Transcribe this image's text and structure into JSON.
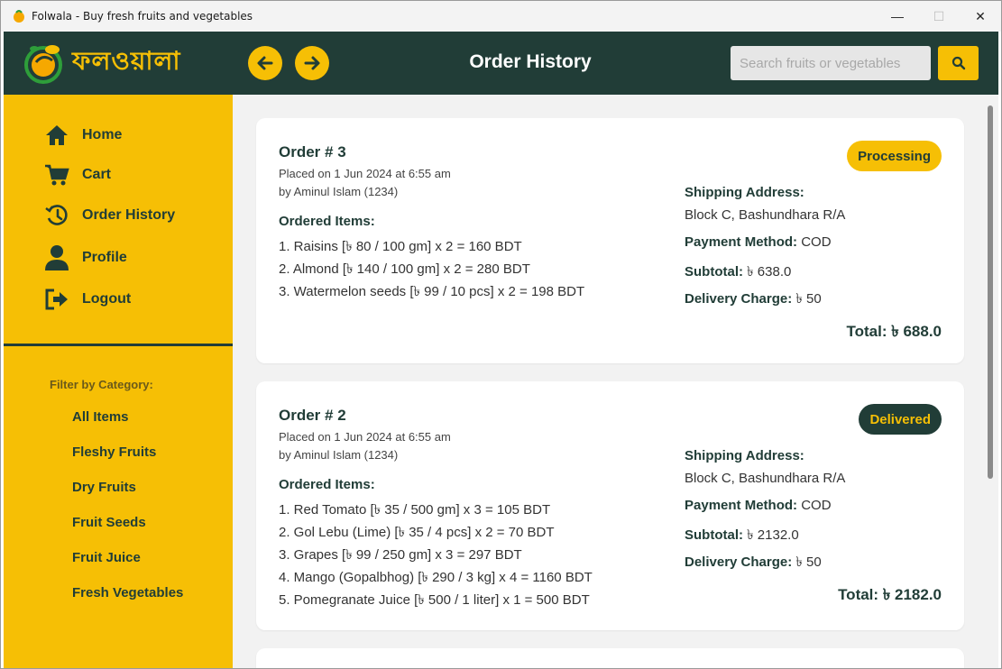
{
  "window": {
    "title": "Folwala - Buy fresh fruits and vegetables",
    "minimize": "—",
    "maximize": "☐",
    "close": "✕"
  },
  "header": {
    "logo_text": "ফলওয়ালা",
    "page_title": "Order History",
    "search_placeholder": "Search fruits or vegetables"
  },
  "sidebar": {
    "menu": [
      {
        "label": "Home",
        "icon": "home-icon"
      },
      {
        "label": "Cart",
        "icon": "cart-icon"
      },
      {
        "label": "Order History",
        "icon": "history-icon"
      },
      {
        "label": "Profile",
        "icon": "user-icon"
      },
      {
        "label": "Logout",
        "icon": "logout-icon"
      }
    ],
    "filter_title": "Filter by Category:",
    "categories": [
      "All Items",
      "Fleshy Fruits",
      "Dry Fruits",
      "Fruit Seeds",
      "Fruit Juice",
      "Fresh Vegetables"
    ]
  },
  "labels": {
    "ordered_items": "Ordered Items:",
    "shipping_address": "Shipping Address:",
    "payment_method": "Payment Method:",
    "subtotal": "Subtotal:",
    "delivery_charge": "Delivery Charge:",
    "total": "Total:"
  },
  "orders": [
    {
      "title": "Order # 3",
      "placed": "Placed on 1 Jun 2024 at 6:55 am",
      "by": "by Aminul Islam (1234)",
      "status": "Processing",
      "items": [
        "1. Raisins [৳ 80 / 100 gm] x 2 = 160 BDT",
        "2. Almond [৳ 140 / 100 gm] x 2 = 280 BDT",
        "3. Watermelon seeds [৳ 99 / 10 pcs] x 2 = 198 BDT"
      ],
      "address": "Block C, Bashundhara R/A",
      "payment": "COD",
      "subtotal": "৳ 638.0",
      "delivery": "৳ 50",
      "total": "৳ 688.0"
    },
    {
      "title": "Order # 2",
      "placed": "Placed on 1 Jun 2024 at 6:55 am",
      "by": "by Aminul Islam (1234)",
      "status": "Delivered",
      "items": [
        "1. Red Tomato [৳ 35 / 500 gm] x 3 = 105 BDT",
        "2. Gol Lebu (Lime) [৳ 35 / 4 pcs] x 2 = 70 BDT",
        "3. Grapes [৳ 99 / 250 gm] x 3 = 297 BDT",
        "4. Mango (Gopalbhog) [৳ 290 / 3 kg] x 4 = 1160 BDT",
        "5. Pomegranate Juice [৳ 500 / 1 liter] x 1 = 500 BDT"
      ],
      "address": "Block C, Bashundhara R/A",
      "payment": "COD",
      "subtotal": "৳ 2132.0",
      "delivery": "৳ 50",
      "total": "৳ 2182.0"
    }
  ],
  "colors": {
    "brand_dark": "#213d37",
    "brand_yellow": "#f6bf05"
  }
}
